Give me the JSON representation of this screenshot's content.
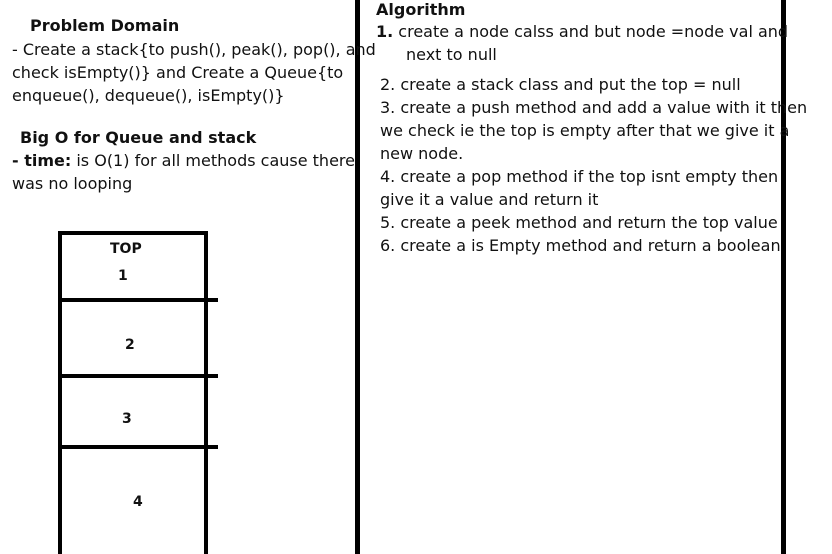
{
  "problem_domain": {
    "title": "Problem Domain",
    "lines": [
      "- Create a stack{to push(), peak(), pop(), and",
      "check isEmpty()} and Create a Queue{to",
      "enqueue(), dequeue(),  isEmpty()}"
    ]
  },
  "big_o": {
    "title": "Big O for Queue and stack",
    "line1_prefix": "- time:",
    "line1_rest": " is O(1) for all methods cause there",
    "line2": "was no looping"
  },
  "algorithm": {
    "title": "Algorithm",
    "step1_num": "1.",
    "step1_a": " create a node calss and but  node =node val and",
    "step1_b": "next to null",
    "step2": "2. create a stack class and put the top = null",
    "step3_a": "3. create a push method and add a value with it then",
    "step3_b": "we check ie the top is empty after that we give it a",
    "step3_c": "new node.",
    "step4_a": "4. create a pop method if the top  isnt empty then",
    "step4_b": "give it a value and return it",
    "step5": "5.  create a peek method and return the top value",
    "step6": "6.  create a is Empty method and return a boolean"
  },
  "stack_diagram": {
    "top_label": "TOP",
    "cells": [
      "1",
      "2",
      "3",
      "4"
    ]
  }
}
